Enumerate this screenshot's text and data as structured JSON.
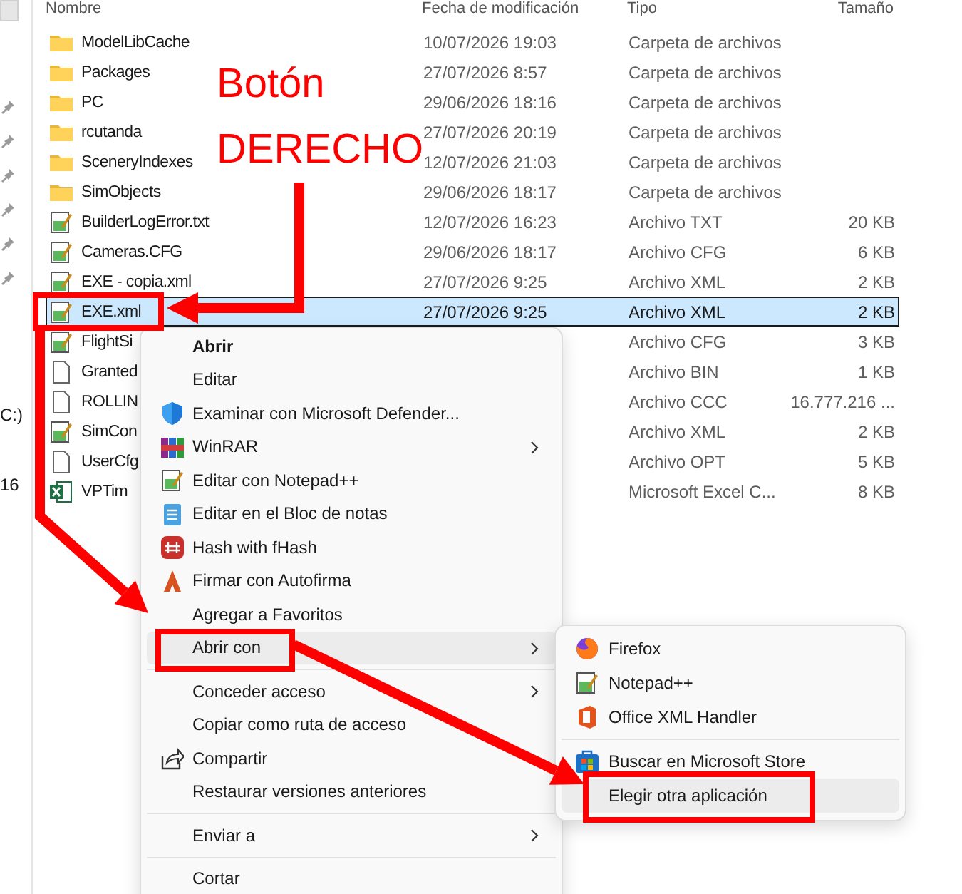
{
  "sidebar": {
    "labels": [
      "C:)",
      "16"
    ]
  },
  "file_list": {
    "columns": [
      "Nombre",
      "Fecha de modificación",
      "Tipo",
      "Tamaño"
    ],
    "rows": [
      {
        "name": "ModelLibCache",
        "kind": "folder",
        "date": "10/07/2026 19:03",
        "type": "Carpeta de archivos",
        "selected": false
      },
      {
        "name": "Packages",
        "kind": "folder",
        "date": "27/07/2026 8:57",
        "type": "Carpeta de archivos",
        "selected": false
      },
      {
        "name": "PC",
        "kind": "folder",
        "date": "29/06/2026 18:16",
        "type": "Carpeta de archivos",
        "selected": false
      },
      {
        "name": "rcutanda",
        "kind": "folder",
        "date": "27/07/2026 20:19",
        "type": "Carpeta de archivos",
        "selected": false
      },
      {
        "name": "SceneryIndexes",
        "kind": "folder",
        "date": "12/07/2026 21:03",
        "type": "Carpeta de archivos",
        "selected": false
      },
      {
        "name": "SimObjects",
        "kind": "folder",
        "date": "29/06/2026 18:17",
        "type": "Carpeta de archivos",
        "selected": false
      },
      {
        "name": "BuilderLogError.txt",
        "kind": "notepad",
        "date": "12/07/2026 16:23",
        "type": "Archivo TXT",
        "size": "20 KB",
        "selected": false
      },
      {
        "name": "Cameras.CFG",
        "kind": "notepad",
        "date": "29/06/2026 18:17",
        "type": "Archivo CFG",
        "size": "6 KB",
        "selected": false
      },
      {
        "name": "EXE - copia.xml",
        "kind": "notepad",
        "date": "27/07/2026 9:25",
        "type": "Archivo XML",
        "size": "2 KB",
        "selected": false
      },
      {
        "name": "EXE.xml",
        "kind": "notepad",
        "date": "27/07/2026 9:25",
        "type": "Archivo XML",
        "size": "2 KB",
        "selected": true
      },
      {
        "name": "FlightSi",
        "kind": "notepad",
        "type": "Archivo CFG",
        "size": "3 KB",
        "selected": false
      },
      {
        "name": "Granted",
        "kind": "blank",
        "type": "Archivo BIN",
        "size": "1 KB",
        "selected": false
      },
      {
        "name": "ROLLIN",
        "kind": "blank",
        "type": "Archivo CCC",
        "size": "16.777.216 ...",
        "selected": false
      },
      {
        "name": "SimCon",
        "kind": "notepad",
        "type": "Archivo XML",
        "size": "2 KB",
        "selected": false
      },
      {
        "name": "UserCfg",
        "kind": "blank",
        "type": "Archivo OPT",
        "size": "5 KB",
        "selected": false
      },
      {
        "name": "VPTim",
        "kind": "excel",
        "type": "Microsoft Excel C...",
        "size": "8 KB",
        "selected": false
      }
    ]
  },
  "context_menu": {
    "groups": [
      [
        {
          "label": "Abrir",
          "kind": "none",
          "default": true,
          "submenu": false,
          "selected": false
        },
        {
          "label": "Editar",
          "kind": "none",
          "default": false,
          "submenu": false,
          "selected": false
        },
        {
          "label": "Examinar con Microsoft Defender...",
          "kind": "shield",
          "default": false,
          "submenu": false,
          "selected": false
        },
        {
          "label": "WinRAR",
          "kind": "archive",
          "default": false,
          "submenu": true,
          "selected": false
        },
        {
          "label": "Editar con Notepad++",
          "kind": "notepad",
          "default": false,
          "submenu": false,
          "selected": false
        },
        {
          "label": "Editar en el Bloc de notas",
          "kind": "notes",
          "default": false,
          "submenu": false,
          "selected": false
        },
        {
          "label": "Hash with fHash",
          "kind": "hash",
          "default": false,
          "submenu": false,
          "selected": false
        },
        {
          "label": "Firmar con Autofirma",
          "kind": "signature",
          "default": false,
          "submenu": false,
          "selected": false
        },
        {
          "label": "Agregar a Favoritos",
          "kind": "none",
          "default": false,
          "submenu": false,
          "selected": false
        },
        {
          "label": "Abrir con",
          "kind": "none",
          "default": false,
          "submenu": true,
          "selected": true
        }
      ],
      [
        {
          "label": "Conceder acceso",
          "kind": "none",
          "default": false,
          "submenu": true,
          "selected": false
        },
        {
          "label": "Copiar como ruta de acceso",
          "kind": "none",
          "default": false,
          "submenu": false,
          "selected": false
        },
        {
          "label": "Compartir",
          "kind": "share",
          "default": false,
          "submenu": false,
          "selected": false
        },
        {
          "label": "Restaurar versiones anteriores",
          "kind": "none",
          "default": false,
          "submenu": false,
          "selected": false
        }
      ],
      [
        {
          "label": "Enviar a",
          "kind": "none",
          "default": false,
          "submenu": true,
          "selected": false
        }
      ],
      [
        {
          "label": "Cortar",
          "kind": "none",
          "default": false,
          "submenu": false,
          "selected": false
        }
      ]
    ]
  },
  "submenu": {
    "groups": [
      [
        {
          "label": "Firefox",
          "kind": "browser",
          "selected": false
        },
        {
          "label": "Notepad++",
          "kind": "notepad",
          "selected": false
        },
        {
          "label": "Office XML Handler",
          "kind": "office",
          "selected": false
        }
      ],
      [
        {
          "label": "Buscar en Microsoft Store",
          "kind": "store",
          "selected": false
        },
        {
          "label": "Elegir otra aplicación",
          "kind": "none",
          "selected": true
        }
      ]
    ]
  },
  "annotations": [
    {
      "text": "Botón"
    },
    {
      "text": "DERECHO"
    }
  ]
}
